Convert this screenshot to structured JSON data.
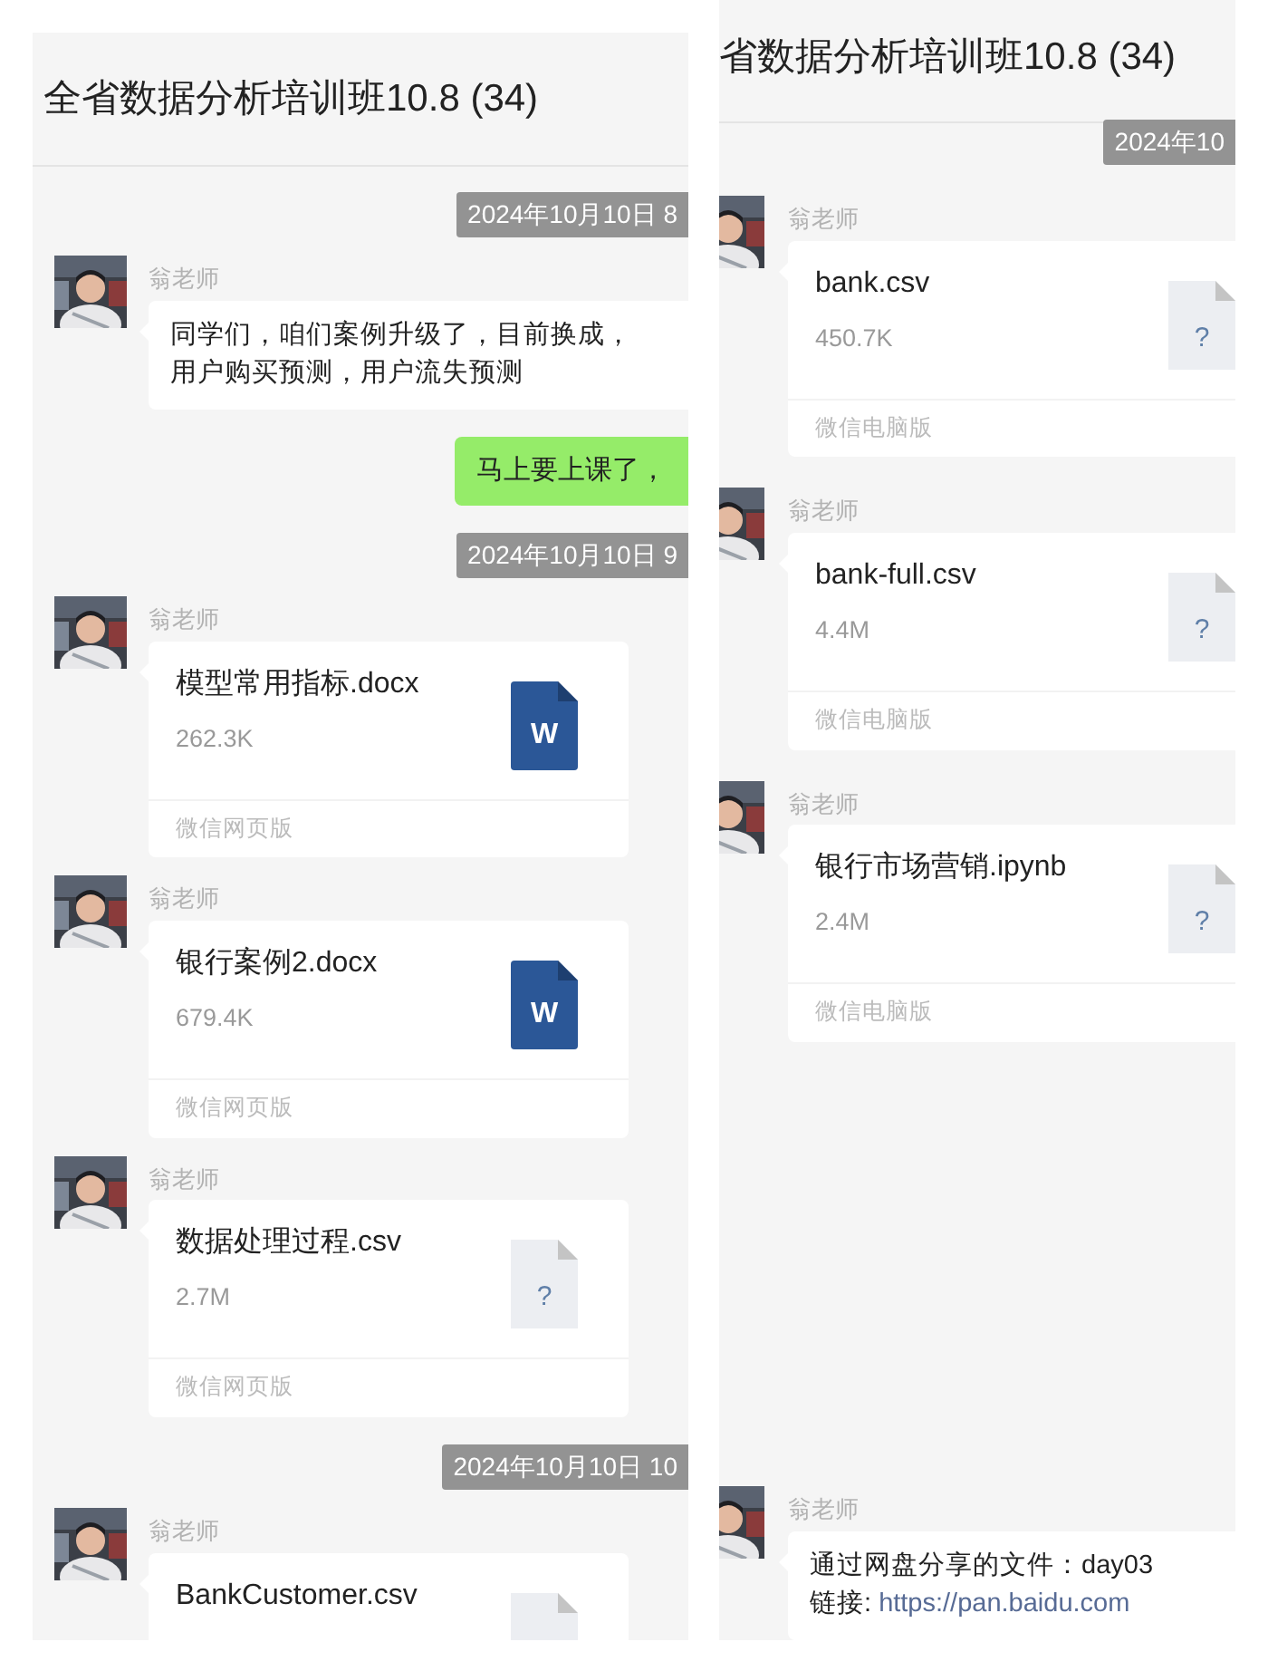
{
  "panels": [
    {
      "title": "全省数据分析培训班10.8 (34)",
      "messages": [
        {
          "kind": "time",
          "text": "2024年10月10日 8"
        },
        {
          "kind": "text",
          "sender": "翁老师",
          "lines": [
            "同学们，咱们案例升级了，目前换成，",
            "用户购买预测，用户流失预测"
          ]
        },
        {
          "kind": "outgoing",
          "text": "马上要上课了，"
        },
        {
          "kind": "time",
          "text": "2024年10月10日 9"
        },
        {
          "kind": "file",
          "sender": "翁老师",
          "name": "模型常用指标.docx",
          "size": "262.3K",
          "icon": {
            "kind": "word",
            "glyph": "W"
          },
          "source": "微信网页版"
        },
        {
          "kind": "file",
          "sender": "翁老师",
          "name": "银行案例2.docx",
          "size": "679.4K",
          "icon": {
            "kind": "word",
            "glyph": "W"
          },
          "source": "微信网页版"
        },
        {
          "kind": "file",
          "sender": "翁老师",
          "name": "数据处理过程.csv",
          "size": "2.7M",
          "icon": {
            "kind": "unknown",
            "glyph": "?"
          },
          "source": "微信网页版"
        },
        {
          "kind": "time",
          "text": "2024年10月10日 10"
        },
        {
          "kind": "file",
          "sender": "翁老师",
          "name": "BankCustomer.csv",
          "icon": {
            "kind": "unknown"
          }
        }
      ]
    },
    {
      "title": "省数据分析培训班10.8 (34)",
      "messages": [
        {
          "kind": "time",
          "text": "2024年10"
        },
        {
          "kind": "file",
          "sender": "翁老师",
          "name": "bank.csv",
          "size": "450.7K",
          "icon": {
            "kind": "unknown",
            "glyph": "?"
          },
          "source": "微信电脑版"
        },
        {
          "kind": "file",
          "sender": "翁老师",
          "name": "bank-full.csv",
          "size": "4.4M",
          "icon": {
            "kind": "unknown",
            "glyph": "?"
          },
          "source": "微信电脑版"
        },
        {
          "kind": "file",
          "sender": "翁老师",
          "name": "银行市场营销.ipynb",
          "size": "2.4M",
          "icon": {
            "kind": "unknown",
            "glyph": "?"
          },
          "source": "微信电脑版"
        },
        {
          "kind": "text",
          "sender": "翁老师",
          "lines": [
            "通过网盘分享的文件：day03"
          ],
          "link_label": "链接: ",
          "link": "https://pan.baidu.com"
        }
      ]
    }
  ]
}
